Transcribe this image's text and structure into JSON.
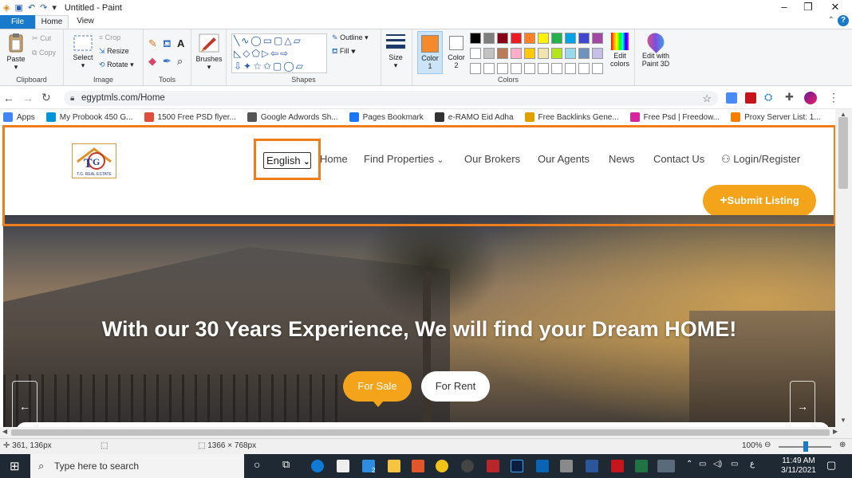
{
  "paint": {
    "title": "Untitled - Paint",
    "tabs": {
      "file": "File",
      "home": "Home",
      "view": "View"
    },
    "clipboard": {
      "group": "Clipboard",
      "paste": "Paste",
      "cut": "Cut",
      "copy": "Copy"
    },
    "image": {
      "group": "Image",
      "select": "Select",
      "crop": "Crop",
      "resize": "Resize",
      "rotate": "Rotate"
    },
    "tools": {
      "group": "Tools"
    },
    "brushes": "Brushes",
    "shapes": {
      "group": "Shapes",
      "outline": "Outline",
      "fill": "Fill"
    },
    "size": "Size",
    "color1": {
      "label": "Color",
      "num": "1",
      "value": "#f58a2c"
    },
    "color2": {
      "label": "Color",
      "num": "2"
    },
    "colors": {
      "group": "Colors"
    },
    "edit_colors": {
      "line1": "Edit",
      "line2": "colors"
    },
    "paint3d": {
      "line1": "Edit with",
      "line2": "Paint 3D"
    },
    "palette": [
      "#000000",
      "#7f7f7f",
      "#880015",
      "#ed1c24",
      "#ff7f27",
      "#fff200",
      "#22b14c",
      "#00a2e8",
      "#3f48cc",
      "#a349a4",
      "#ffffff",
      "#c3c3c3",
      "#b97a57",
      "#ffaec9",
      "#ffc90e",
      "#efe4b0",
      "#b5e61d",
      "#99d9ea",
      "#7092be",
      "#c8bfe7"
    ]
  },
  "browser": {
    "url": "egyptmls.com/Home",
    "bookmarks": [
      {
        "label": "Apps",
        "icon": "apps-grid-icon",
        "color": "#4285f4"
      },
      {
        "label": "My Probook 450 G...",
        "icon": "hp-icon",
        "color": "#0096d6"
      },
      {
        "label": "1500 Free PSD flyer...",
        "icon": "psd-icon",
        "color": "#e04d3b"
      },
      {
        "label": "Google Adwords Sh...",
        "icon": "globe-icon",
        "color": "#555555"
      },
      {
        "label": "Pages Bookmark",
        "icon": "facebook-icon",
        "color": "#1877f2"
      },
      {
        "label": "e-RAMO Eid Adha",
        "icon": "eramo-icon",
        "color": "#333333"
      },
      {
        "label": "Free Backlinks Gene...",
        "icon": "backlinks-icon",
        "color": "#e0a000"
      },
      {
        "label": "Free Psd | Freedow...",
        "icon": "freedow-icon",
        "color": "#d6249f"
      },
      {
        "label": "Proxy Server List: 1...",
        "icon": "blogger-icon",
        "color": "#f57d00"
      }
    ]
  },
  "site": {
    "logo_text": "T.G. REAL ESTATE",
    "language": "English",
    "nav": {
      "home": "Home",
      "find": "Find Properties",
      "brokers": "Our Brokers",
      "agents": "Our Agents",
      "news": "News",
      "contact": "Contact Us",
      "login": "Login/Register"
    },
    "submit": "Submit Listing",
    "hero_heading": "With our 30 Years Experience, We will find  your Dream HOME!",
    "for_sale": "For Sale",
    "for_rent": "For Rent",
    "accent": "#f4a41b"
  },
  "status": {
    "cursor": "361, 136px",
    "canvas": "1366 × 768px",
    "zoom": "100%"
  },
  "taskbar": {
    "search": "Type here to search",
    "time": "11:49 AM",
    "date": "3/11/2021",
    "badge": "2"
  }
}
